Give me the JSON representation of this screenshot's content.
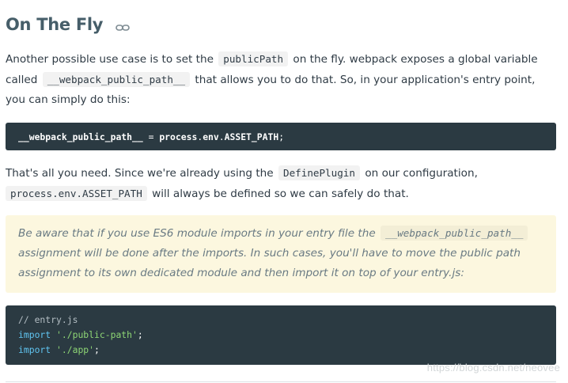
{
  "section": {
    "title": "On The Fly",
    "anchor_icon": "link-icon"
  },
  "para1": {
    "t1": "Another possible use case is to set the",
    "c1": "publicPath",
    "t2": "on the fly. webpack exposes a global variable",
    "t3": "called",
    "c2": "__webpack_public_path__",
    "t4": "that allows you to do that. So, in your application's entry point,",
    "t5": "you can simply do this:"
  },
  "code1": {
    "a": "__webpack_public_path__",
    "b": " = ",
    "c": "process",
    "d": ".",
    "e": "env",
    "f": ".",
    "g": "ASSET_PATH",
    "h": ";"
  },
  "para2": {
    "t1": "That's all you need. Since we're already using the",
    "c1": "DefinePlugin",
    "t2": "on our configuration,",
    "c2": "process.env.ASSET_PATH",
    "t3": "will always be defined so we can safely do that."
  },
  "callout": {
    "t1": "Be aware that if you use ES6 module imports in your entry file the",
    "c1": "__webpack_public_path__",
    "t2": "assignment will be done after the imports. In such cases, you'll have to move the public path",
    "t3": "assignment to its own dedicated module and then import it on top of your entry.js:"
  },
  "code2": {
    "comment": "// entry.js",
    "kw1": "import",
    "str1": "'./public-path'",
    "semi1": ";",
    "kw2": "import",
    "str2": "'./app'",
    "semi2": ";"
  },
  "watermark": "https://blog.csdn.net/neovee",
  "colors": {
    "heading": "#465e69",
    "text": "#2f3b45",
    "code_bg": "#2b3a42",
    "callout_bg": "#fcf7df",
    "keyword": "#60c4f0",
    "string": "#8ed675"
  }
}
